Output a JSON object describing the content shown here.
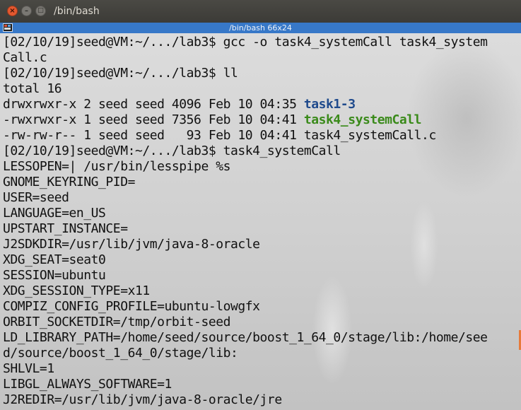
{
  "window": {
    "title": "/bin/bash"
  },
  "tab": {
    "title": "/bin/bash 66x24"
  },
  "terminal": {
    "lines": [
      "[02/10/19]seed@VM:~/.../lab3$ gcc -o task4_systemCall task4_system",
      "Call.c",
      "[02/10/19]seed@VM:~/.../lab3$ ll",
      "total 16",
      {
        "prefix": "drwxrwxr-x 2 seed seed 4096 Feb 10 04:35 ",
        "name": "task1-3",
        "kind": "dir"
      },
      {
        "prefix": "-rwxrwxr-x 1 seed seed 7356 Feb 10 04:41 ",
        "name": "task4_systemCall",
        "kind": "exe"
      },
      "-rw-rw-r-- 1 seed seed   93 Feb 10 04:41 task4_systemCall.c",
      "[02/10/19]seed@VM:~/.../lab3$ task4_systemCall",
      "LESSOPEN=| /usr/bin/lesspipe %s",
      "GNOME_KEYRING_PID=",
      "USER=seed",
      "LANGUAGE=en_US",
      "UPSTART_INSTANCE=",
      "J2SDKDIR=/usr/lib/jvm/java-8-oracle",
      "XDG_SEAT=seat0",
      "SESSION=ubuntu",
      "XDG_SESSION_TYPE=x11",
      "COMPIZ_CONFIG_PROFILE=ubuntu-lowgfx",
      "ORBIT_SOCKETDIR=/tmp/orbit-seed",
      "LD_LIBRARY_PATH=/home/seed/source/boost_1_64_0/stage/lib:/home/see",
      "d/source/boost_1_64_0/stage/lib:",
      "SHLVL=1",
      "LIBGL_ALWAYS_SOFTWARE=1",
      "J2REDIR=/usr/lib/jvm/java-8-oracle/jre"
    ]
  },
  "colors": {
    "dir": "#1f4a8c",
    "exe": "#3a8a1a",
    "text": "#111111",
    "tabbar": "#3778c8"
  }
}
